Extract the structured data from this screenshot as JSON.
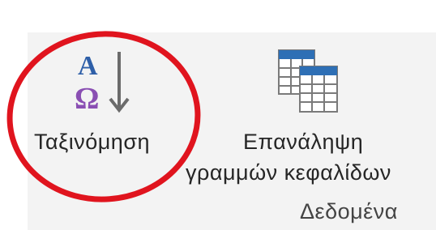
{
  "ribbon": {
    "group_label": "Δεδομένα",
    "sort_button": {
      "label": "Ταξινόμηση",
      "icon": "sort-a-omega-icon",
      "icon_top_letter": "A",
      "icon_bottom_letter": "Ω"
    },
    "repeat_header_button": {
      "label_line1": "Επανάληψη",
      "label_line2": "γραμμών κεφαλίδων",
      "icon": "repeat-header-rows-icon"
    }
  },
  "annotation": {
    "highlight_color": "#e0141e",
    "target": "sort-button"
  },
  "colors": {
    "ribbon_background": "#f3f3f3",
    "sort_letter_a": "#2e5fa8",
    "sort_letter_omega": "#8a4fb3",
    "arrow": "#6b6b6b",
    "table_header": "#2e6fb5"
  }
}
